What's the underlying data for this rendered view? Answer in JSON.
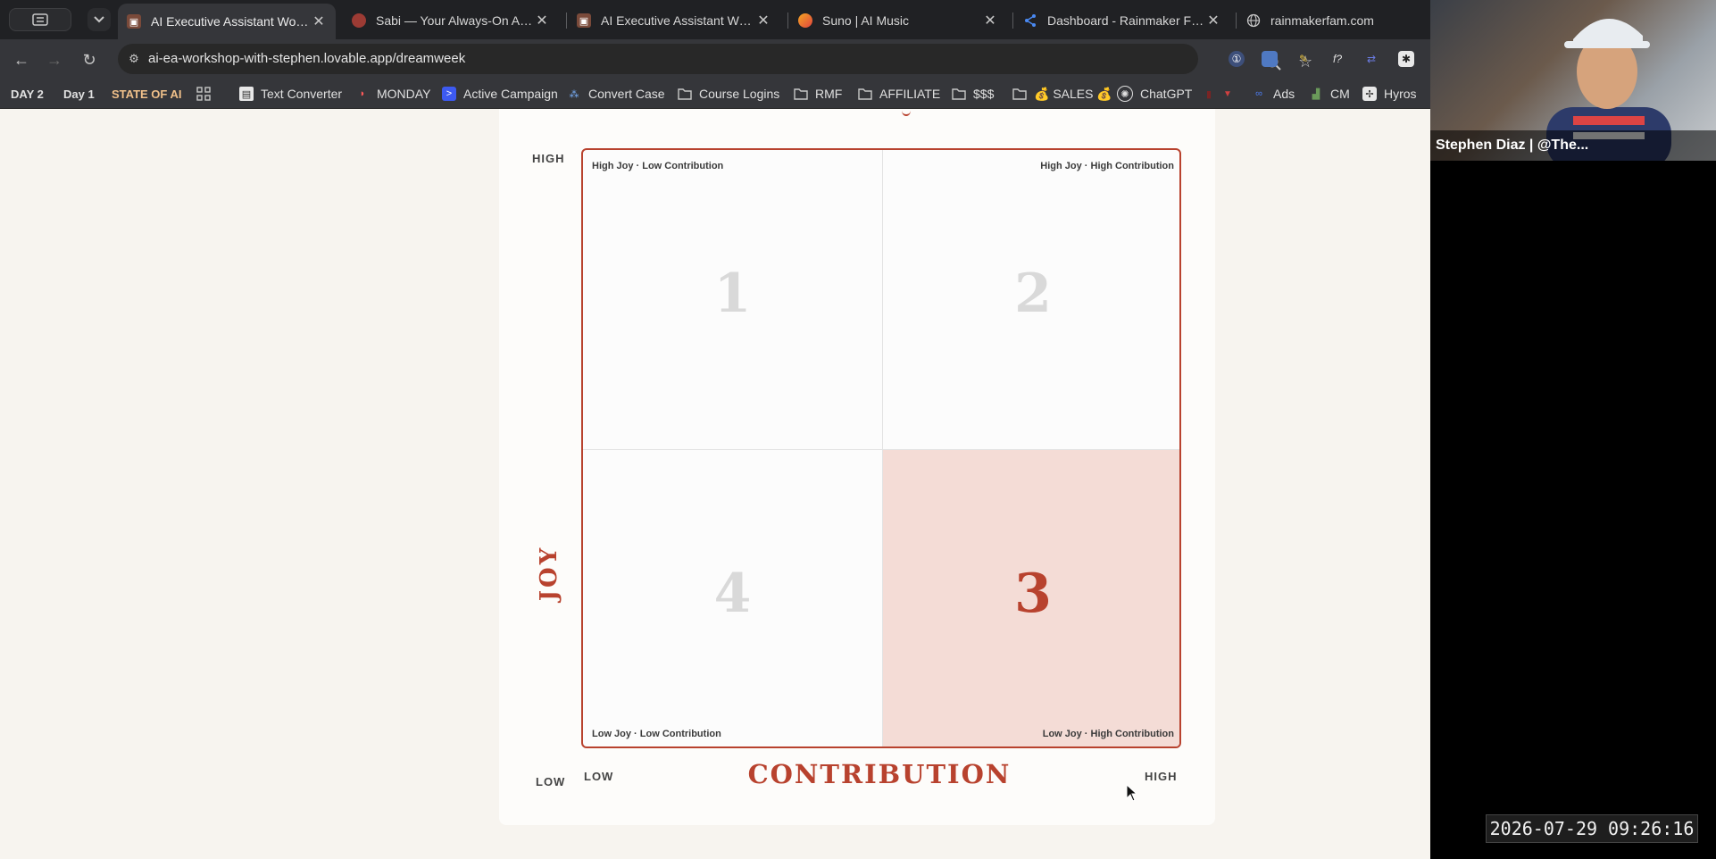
{
  "browser": {
    "tabs": [
      {
        "title": "AI Executive Assistant Workshop",
        "active": true
      },
      {
        "title": "Sabi — Your Always-On AI Assistant",
        "active": false
      },
      {
        "title": "AI Executive Assistant Workshop",
        "active": false
      },
      {
        "title": "Suno | AI Music",
        "active": false
      },
      {
        "title": "Dashboard - Rainmaker Family",
        "active": false
      },
      {
        "title": "rainmakerfam.com",
        "active": false
      }
    ],
    "url": "ai-ea-workshop-with-stephen.lovable.app/dreamweek",
    "bookmarks": [
      {
        "label": "DAY 2",
        "icon": "none"
      },
      {
        "label": "Day 1",
        "icon": "none"
      },
      {
        "label": "STATE OF AI",
        "icon": "none"
      },
      {
        "label": "",
        "icon": "apps-grid-icon"
      },
      {
        "label": "Text Converter",
        "icon": "page-icon"
      },
      {
        "label": "MONDAY",
        "icon": "monday-icon"
      },
      {
        "label": "Active Campaign",
        "icon": "activecampaign-icon"
      },
      {
        "label": "Convert Case",
        "icon": "convertcase-icon"
      },
      {
        "label": "Course Logins",
        "icon": "folder-icon"
      },
      {
        "label": "RMF",
        "icon": "folder-icon"
      },
      {
        "label": "AFFILIATE",
        "icon": "folder-icon"
      },
      {
        "label": "$$$",
        "icon": "folder-icon"
      },
      {
        "label": "💰 SALES 💰",
        "icon": "folder-icon"
      },
      {
        "label": "ChatGPT",
        "icon": "chatgpt-icon"
      },
      {
        "label": "Ads",
        "icon": "meta-icon"
      },
      {
        "label": "CM",
        "icon": "cm-icon"
      },
      {
        "label": "Hyros",
        "icon": "hyros-icon"
      }
    ]
  },
  "matrix": {
    "y_axis_title": "JOY",
    "x_axis_title": "CONTRIBUTION",
    "y_high": "HIGH",
    "y_low": "LOW",
    "x_low": "LOW",
    "x_high": "HIGH",
    "quadrants": [
      {
        "id": "q1",
        "number": "1",
        "label": "High Joy · Low Contribution",
        "highlighted": false
      },
      {
        "id": "q2",
        "number": "2",
        "label": "High Joy · High Contribution",
        "highlighted": false
      },
      {
        "id": "q4",
        "number": "4",
        "label": "Low Joy · Low Contribution",
        "highlighted": false
      },
      {
        "id": "q3",
        "number": "3",
        "label": "Low Joy · High Contribution",
        "highlighted": true
      }
    ],
    "accent_color": "#b8422e",
    "highlight_fill": "#f4dcd6"
  },
  "overlay": {
    "webcam_caption": "Stephen Diaz | @The...",
    "timestamp": "2026-07-29 09:26:16"
  }
}
